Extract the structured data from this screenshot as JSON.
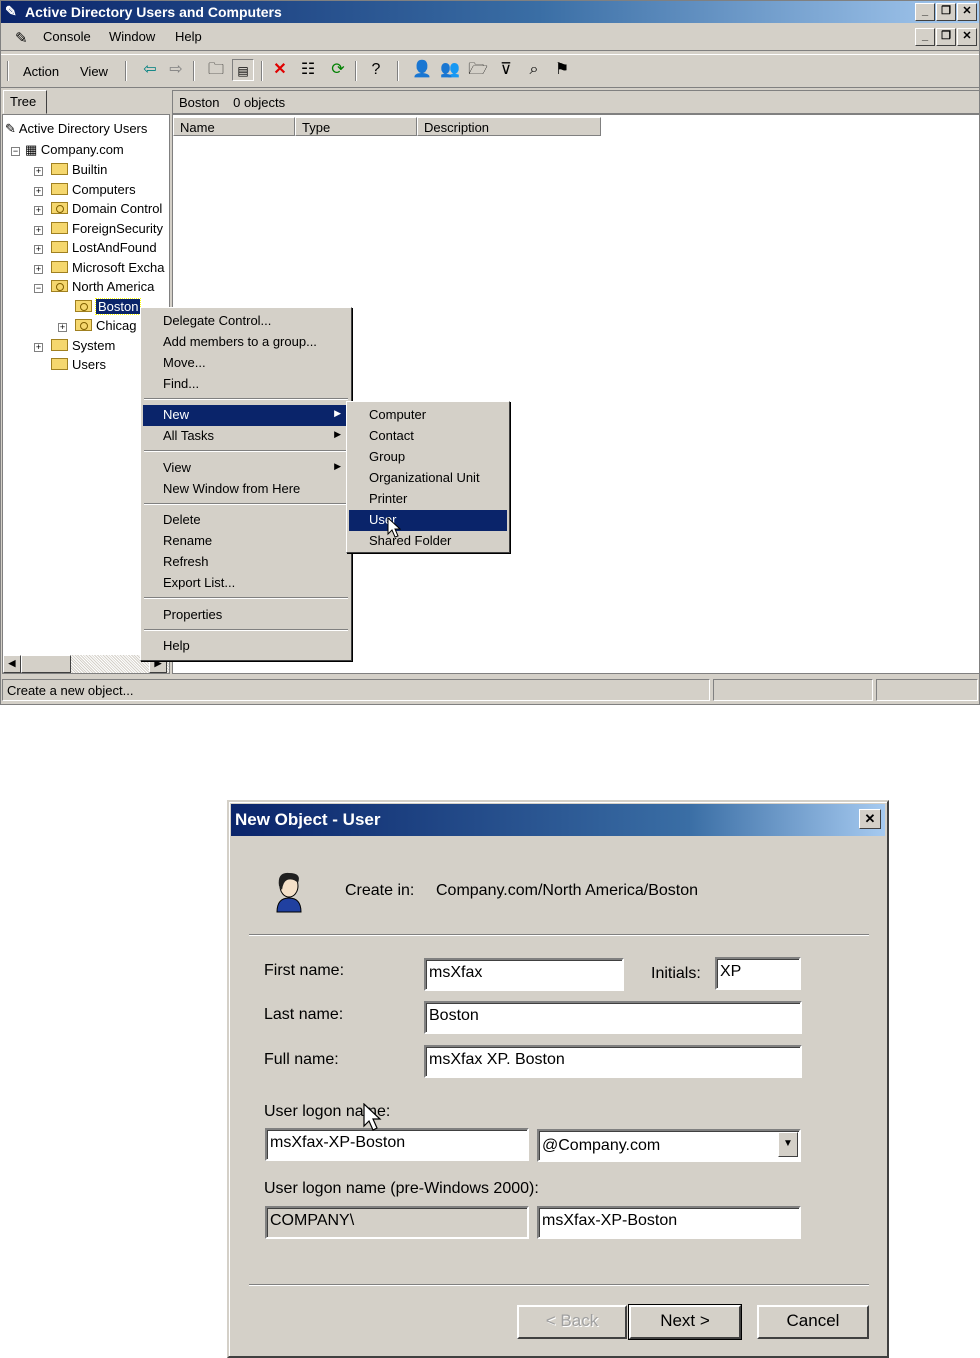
{
  "mmc": {
    "title": "Active Directory Users and Computers",
    "menubar": [
      {
        "label": "Console"
      },
      {
        "label": "Window"
      },
      {
        "label": "Help"
      }
    ],
    "actionbar": [
      {
        "label": "Action"
      },
      {
        "label": "View"
      }
    ],
    "tree_tab": "Tree",
    "tree": {
      "root": "Active Directory Users",
      "domain": "Company.com",
      "items": [
        "Builtin",
        "Computers",
        "Domain Control",
        "ForeignSecurity",
        "LostAndFound",
        "Microsoft Excha",
        "North America",
        "System",
        "Users"
      ],
      "child_boston": "Boston",
      "child_chicago": "Chicag"
    },
    "list": {
      "path": "Boston",
      "count": "0 objects",
      "columns": [
        "Name",
        "Type",
        "Description"
      ]
    },
    "status": "Create a new object..."
  },
  "context_menu": {
    "items": [
      "Delegate Control...",
      "Add members to a group...",
      "Move...",
      "Find...",
      "New",
      "All Tasks",
      "View",
      "New Window from Here",
      "Delete",
      "Rename",
      "Refresh",
      "Export List...",
      "Properties",
      "Help"
    ]
  },
  "submenu": {
    "items": [
      "Computer",
      "Contact",
      "Group",
      "Organizational Unit",
      "Printer",
      "User",
      "Shared Folder"
    ]
  },
  "dialog": {
    "title": "New Object - User",
    "create_in_label": "Create in:",
    "create_in_value": "Company.com/North America/Boston",
    "first_name_label": "First name:",
    "first_name": "msXfax",
    "initials_label": "Initials:",
    "initials": "XP",
    "last_name_label": "Last name:",
    "last_name": "Boston",
    "full_name_label": "Full name:",
    "full_name": "msXfax XP. Boston",
    "logon_label": "User logon name:",
    "logon_name": "msXfax-XP-Boston",
    "upn_suffix": "@Company.com",
    "pre2000_label": "User logon name (pre-Windows 2000):",
    "pre2000_domain": "COMPANY\\",
    "pre2000_name": "msXfax-XP-Boston",
    "back_button": "< Back",
    "next_button": "Next >",
    "cancel_button": "Cancel"
  }
}
